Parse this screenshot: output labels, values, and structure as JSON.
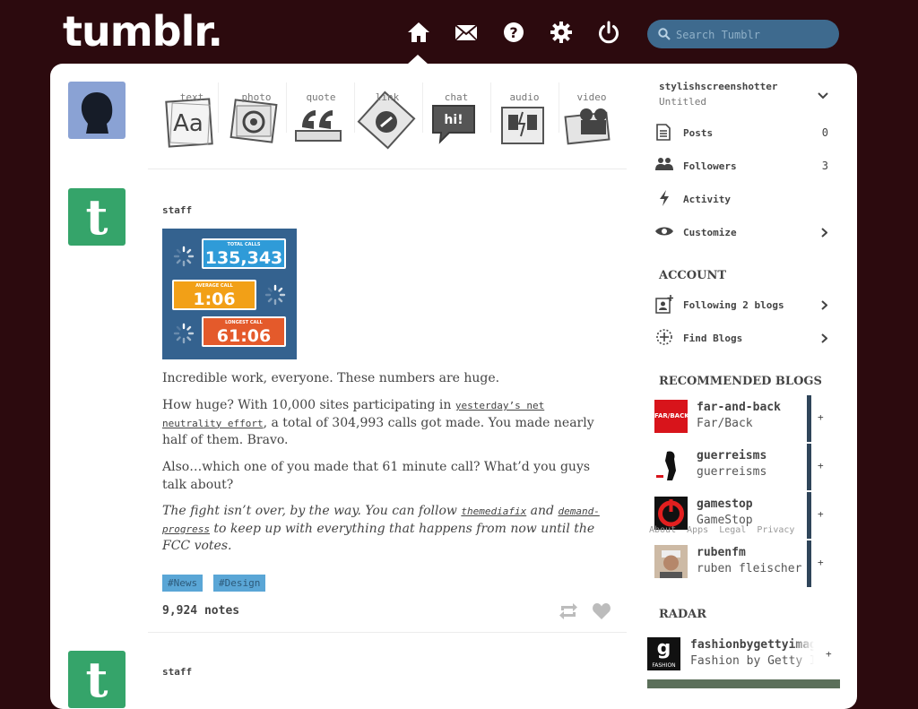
{
  "header": {
    "logo": "tumblr.",
    "search_placeholder": "Search Tumblr",
    "nav_icons": [
      "home-icon",
      "inbox-icon",
      "help-icon",
      "settings-icon",
      "logout-icon"
    ]
  },
  "post_types": [
    {
      "label": "text",
      "icon": "text-post-icon"
    },
    {
      "label": "photo",
      "icon": "photo-post-icon"
    },
    {
      "label": "quote",
      "icon": "quote-post-icon"
    },
    {
      "label": "link",
      "icon": "link-post-icon"
    },
    {
      "label": "chat",
      "icon": "chat-post-icon"
    },
    {
      "label": "audio",
      "icon": "audio-post-icon"
    },
    {
      "label": "video",
      "icon": "video-post-icon"
    }
  ],
  "post": {
    "author": "staff",
    "stats": [
      {
        "caption": "TOTAL CALLS",
        "value": "135,343",
        "color": "#2f9bd8"
      },
      {
        "caption": "AVERAGE CALL",
        "value": "1:06",
        "color": "#f2a017"
      },
      {
        "caption": "LONGEST CALL",
        "value": "61:06",
        "color": "#e45a2b"
      }
    ],
    "p1": "Incredible work, everyone. These numbers are huge.",
    "p2_a": "How huge? With 10,000 sites participating in ",
    "p2_link": "yesterday’s net neutrality effort",
    "p2_b": ", a total of 304,993 calls got made. You made nearly half of them. Bravo.",
    "p3": "Also…which one of you made that 61 minute call? What’d you guys talk about?",
    "p4_a": "The fight isn’t over, by the way. You can follow ",
    "p4_link1": "themediafix",
    "p4_mid": " and ",
    "p4_link2": "demand-progress",
    "p4_b": " to keep up with everything that happens from now until the FCC votes.",
    "tags": [
      "#News",
      "#Design"
    ],
    "notes": "9,924 notes"
  },
  "next_post": {
    "author": "staff"
  },
  "sidebar": {
    "blog_name": "stylishscreenshotter",
    "blog_title": "Untitled",
    "items": [
      {
        "label": "Posts",
        "count": "0"
      },
      {
        "label": "Followers",
        "count": "3"
      },
      {
        "label": "Activity"
      },
      {
        "label": "Customize"
      }
    ],
    "account_heading": "ACCOUNT",
    "account_items": [
      {
        "label": "Following 2 blogs"
      },
      {
        "label": "Find Blogs"
      }
    ],
    "recommended_heading": "RECOMMENDED BLOGS",
    "recommended": [
      {
        "name": "far-and-back",
        "title": "Far/Back",
        "avatar_text": "FAR/BACK"
      },
      {
        "name": "guerreisms",
        "title": "guerreisms"
      },
      {
        "name": "gamestop",
        "title": "GameStop"
      },
      {
        "name": "rubenfm",
        "title": "ruben fleischer"
      }
    ],
    "follow_label": "+",
    "footer_links": [
      "About",
      "Apps",
      "Legal",
      "Privacy"
    ],
    "radar_heading": "RADAR",
    "radar": {
      "name": "fashionbygettyimages",
      "title": "Fashion by Getty Images",
      "avatar_letter": "g",
      "avatar_caption": "FASHION"
    }
  }
}
